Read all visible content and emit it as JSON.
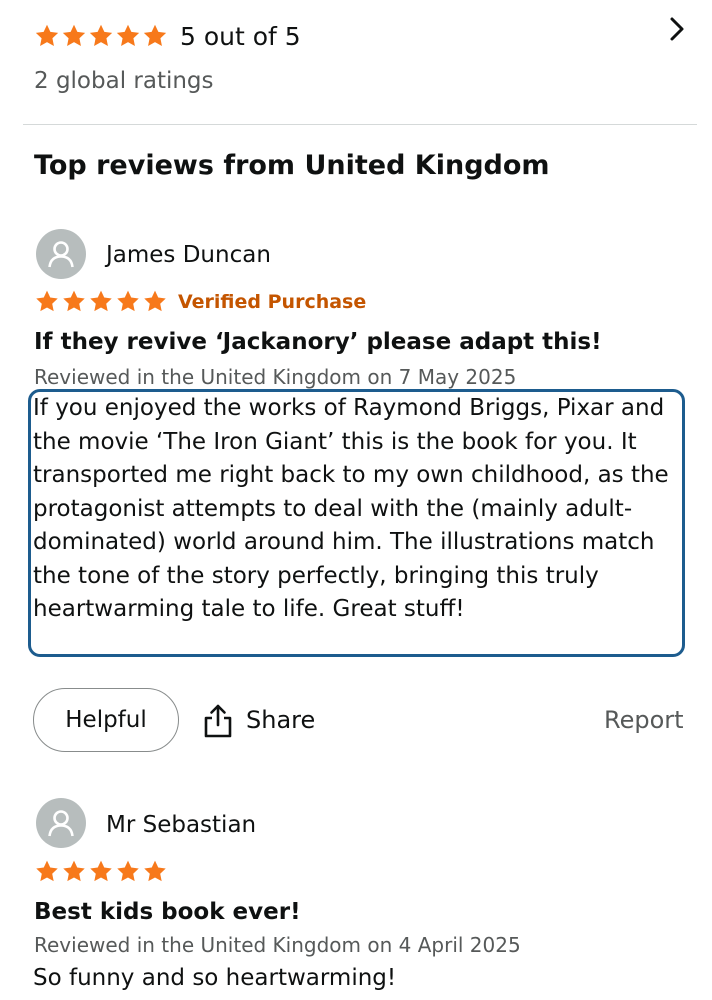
{
  "summary": {
    "rating": 5,
    "rating_text": "5 out of 5",
    "global_ratings": "2 global ratings"
  },
  "section_title": "Top reviews from United Kingdom",
  "colors": {
    "star": "#f7791b",
    "verified": "#c45500",
    "focus_border": "#1d5c8e"
  },
  "reviews": [
    {
      "reviewer": "James Duncan",
      "rating": 5,
      "verified": "Verified Purchase",
      "title": "If they revive ‘Jackanory’ please adapt this!",
      "meta": "Reviewed in the United Kingdom on 7 May 2025",
      "body": "If you enjoyed the works of Raymond Briggs, Pixar and the movie ‘The Iron Giant’ this is the book for you. It transported me right back to my own childhood, as the protagonist attempts to deal with the (mainly adult-dominated) world around him. The illustrations match the tone of the story perfectly, bringing this truly heartwarming tale to life. Great stuff!",
      "actions": {
        "helpful": "Helpful",
        "share": "Share",
        "report": "Report"
      }
    },
    {
      "reviewer": "Mr Sebastian",
      "rating": 5,
      "title": "Best kids book ever!",
      "meta": "Reviewed in the United Kingdom on 4 April 2025",
      "body": "So funny and so heartwarming!"
    }
  ],
  "icons": {
    "star": "star-icon",
    "chevron": "chevron-right-icon",
    "avatar": "user-avatar-icon",
    "share": "share-icon"
  }
}
